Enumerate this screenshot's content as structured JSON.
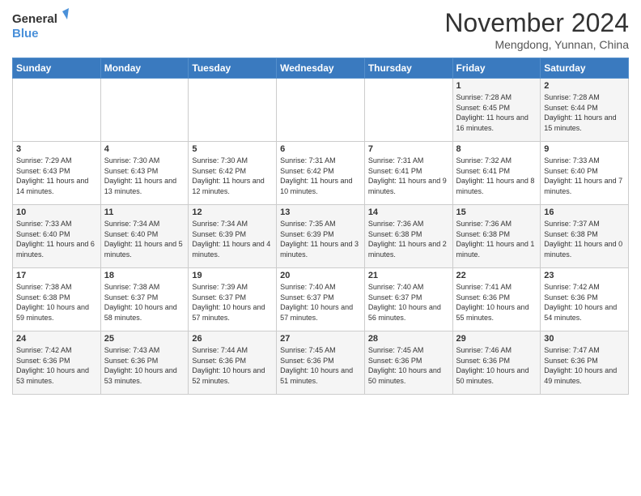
{
  "logo": {
    "line1": "General",
    "line2": "Blue"
  },
  "title": "November 2024",
  "subtitle": "Mengdong, Yunnan, China",
  "weekdays": [
    "Sunday",
    "Monday",
    "Tuesday",
    "Wednesday",
    "Thursday",
    "Friday",
    "Saturday"
  ],
  "weeks": [
    [
      {
        "day": "",
        "info": ""
      },
      {
        "day": "",
        "info": ""
      },
      {
        "day": "",
        "info": ""
      },
      {
        "day": "",
        "info": ""
      },
      {
        "day": "",
        "info": ""
      },
      {
        "day": "1",
        "info": "Sunrise: 7:28 AM\nSunset: 6:45 PM\nDaylight: 11 hours and 16 minutes."
      },
      {
        "day": "2",
        "info": "Sunrise: 7:28 AM\nSunset: 6:44 PM\nDaylight: 11 hours and 15 minutes."
      }
    ],
    [
      {
        "day": "3",
        "info": "Sunrise: 7:29 AM\nSunset: 6:43 PM\nDaylight: 11 hours and 14 minutes."
      },
      {
        "day": "4",
        "info": "Sunrise: 7:30 AM\nSunset: 6:43 PM\nDaylight: 11 hours and 13 minutes."
      },
      {
        "day": "5",
        "info": "Sunrise: 7:30 AM\nSunset: 6:42 PM\nDaylight: 11 hours and 12 minutes."
      },
      {
        "day": "6",
        "info": "Sunrise: 7:31 AM\nSunset: 6:42 PM\nDaylight: 11 hours and 10 minutes."
      },
      {
        "day": "7",
        "info": "Sunrise: 7:31 AM\nSunset: 6:41 PM\nDaylight: 11 hours and 9 minutes."
      },
      {
        "day": "8",
        "info": "Sunrise: 7:32 AM\nSunset: 6:41 PM\nDaylight: 11 hours and 8 minutes."
      },
      {
        "day": "9",
        "info": "Sunrise: 7:33 AM\nSunset: 6:40 PM\nDaylight: 11 hours and 7 minutes."
      }
    ],
    [
      {
        "day": "10",
        "info": "Sunrise: 7:33 AM\nSunset: 6:40 PM\nDaylight: 11 hours and 6 minutes."
      },
      {
        "day": "11",
        "info": "Sunrise: 7:34 AM\nSunset: 6:40 PM\nDaylight: 11 hours and 5 minutes."
      },
      {
        "day": "12",
        "info": "Sunrise: 7:34 AM\nSunset: 6:39 PM\nDaylight: 11 hours and 4 minutes."
      },
      {
        "day": "13",
        "info": "Sunrise: 7:35 AM\nSunset: 6:39 PM\nDaylight: 11 hours and 3 minutes."
      },
      {
        "day": "14",
        "info": "Sunrise: 7:36 AM\nSunset: 6:38 PM\nDaylight: 11 hours and 2 minutes."
      },
      {
        "day": "15",
        "info": "Sunrise: 7:36 AM\nSunset: 6:38 PM\nDaylight: 11 hours and 1 minute."
      },
      {
        "day": "16",
        "info": "Sunrise: 7:37 AM\nSunset: 6:38 PM\nDaylight: 11 hours and 0 minutes."
      }
    ],
    [
      {
        "day": "17",
        "info": "Sunrise: 7:38 AM\nSunset: 6:38 PM\nDaylight: 10 hours and 59 minutes."
      },
      {
        "day": "18",
        "info": "Sunrise: 7:38 AM\nSunset: 6:37 PM\nDaylight: 10 hours and 58 minutes."
      },
      {
        "day": "19",
        "info": "Sunrise: 7:39 AM\nSunset: 6:37 PM\nDaylight: 10 hours and 57 minutes."
      },
      {
        "day": "20",
        "info": "Sunrise: 7:40 AM\nSunset: 6:37 PM\nDaylight: 10 hours and 57 minutes."
      },
      {
        "day": "21",
        "info": "Sunrise: 7:40 AM\nSunset: 6:37 PM\nDaylight: 10 hours and 56 minutes."
      },
      {
        "day": "22",
        "info": "Sunrise: 7:41 AM\nSunset: 6:36 PM\nDaylight: 10 hours and 55 minutes."
      },
      {
        "day": "23",
        "info": "Sunrise: 7:42 AM\nSunset: 6:36 PM\nDaylight: 10 hours and 54 minutes."
      }
    ],
    [
      {
        "day": "24",
        "info": "Sunrise: 7:42 AM\nSunset: 6:36 PM\nDaylight: 10 hours and 53 minutes."
      },
      {
        "day": "25",
        "info": "Sunrise: 7:43 AM\nSunset: 6:36 PM\nDaylight: 10 hours and 53 minutes."
      },
      {
        "day": "26",
        "info": "Sunrise: 7:44 AM\nSunset: 6:36 PM\nDaylight: 10 hours and 52 minutes."
      },
      {
        "day": "27",
        "info": "Sunrise: 7:45 AM\nSunset: 6:36 PM\nDaylight: 10 hours and 51 minutes."
      },
      {
        "day": "28",
        "info": "Sunrise: 7:45 AM\nSunset: 6:36 PM\nDaylight: 10 hours and 50 minutes."
      },
      {
        "day": "29",
        "info": "Sunrise: 7:46 AM\nSunset: 6:36 PM\nDaylight: 10 hours and 50 minutes."
      },
      {
        "day": "30",
        "info": "Sunrise: 7:47 AM\nSunset: 6:36 PM\nDaylight: 10 hours and 49 minutes."
      }
    ]
  ]
}
